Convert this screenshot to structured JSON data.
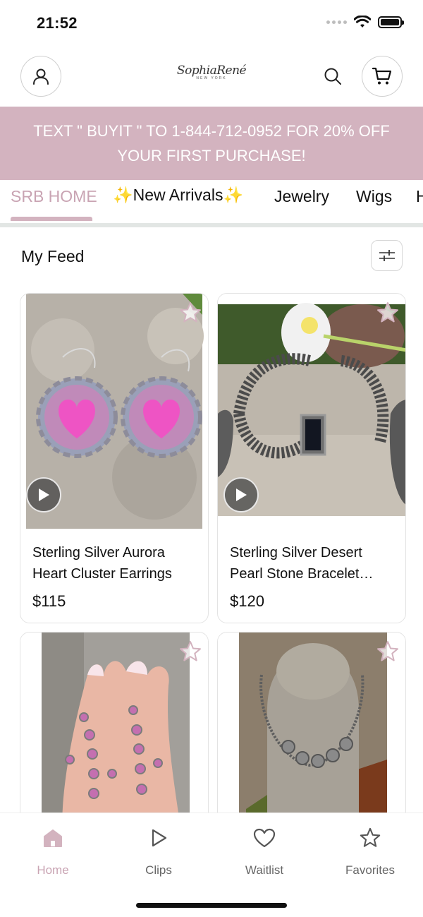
{
  "status_bar": {
    "time": "21:52"
  },
  "header": {
    "logo_text": "SophiaRené",
    "logo_subtext": "NEW YORK",
    "account_icon": "user-icon",
    "search_icon": "search-icon",
    "cart_icon": "cart-icon"
  },
  "promo": {
    "text": "TEXT \" BUYIT \" TO 1-844-712-0952 FOR 20% OFF YOUR FIRST PURCHASE!"
  },
  "tabs": [
    {
      "label": "SRB HOME",
      "active": true
    },
    {
      "label": "✨New Arrivals✨"
    },
    {
      "label": "Jewelry"
    },
    {
      "label": "Wigs"
    },
    {
      "label": "H"
    }
  ],
  "feed": {
    "title": "My Feed",
    "filter_icon": "sliders-icon"
  },
  "products": [
    {
      "name": "Sterling Silver Aurora Heart Cluster Earrings",
      "price": "$115",
      "has_video": true
    },
    {
      "name": "Sterling Silver Desert Pearl Stone Bracelet…",
      "price": "$120",
      "has_video": true
    },
    {
      "name": "",
      "price": ""
    },
    {
      "name": "",
      "price": ""
    }
  ],
  "bottom_nav": [
    {
      "label": "Home",
      "icon": "home-icon",
      "active": true
    },
    {
      "label": "Clips",
      "icon": "play-icon"
    },
    {
      "label": "Waitlist",
      "icon": "heart-icon"
    },
    {
      "label": "Favorites",
      "icon": "star-icon"
    }
  ],
  "colors": {
    "accent": "#d3b3bf",
    "accent_text": "#c9a4b3"
  }
}
